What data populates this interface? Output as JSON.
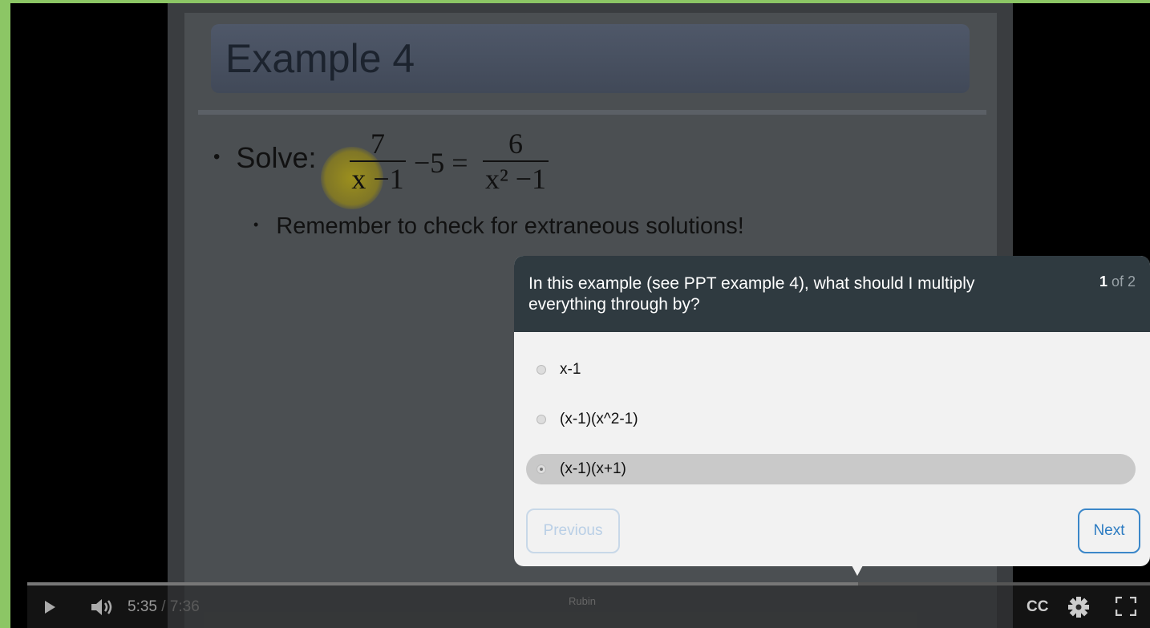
{
  "slide": {
    "title": "Example 4",
    "bullet1_label": "Solve:",
    "equation": {
      "lhs_num": "7",
      "lhs_den": "x −1",
      "middle": "−5 =",
      "rhs_num": "6",
      "rhs_den": "x² −1"
    },
    "bullet2": "Remember to check for extraneous solutions!"
  },
  "quiz": {
    "question": "In this example (see PPT example 4), what should I multiply everything through by?",
    "counter_current": "1",
    "counter_total": "of 2",
    "options": [
      {
        "label": "x-1",
        "selected": false
      },
      {
        "label": "(x-1)(x^2-1)",
        "selected": false
      },
      {
        "label": "(x-1)(x+1)",
        "selected": true
      }
    ],
    "previous_label": "Previous",
    "next_label": "Next"
  },
  "player": {
    "current_time": "5:35",
    "duration": "/ 7:36",
    "progress": 0.74,
    "chapter": "Rubin",
    "cc_label": "CC",
    "icons": [
      "play-icon",
      "volume-icon",
      "gear-icon",
      "fullscreen-icon"
    ]
  },
  "colors": {
    "frame": "#8cc665",
    "quiz_header": "#2f3a40",
    "next_border": "#3b87c9"
  }
}
